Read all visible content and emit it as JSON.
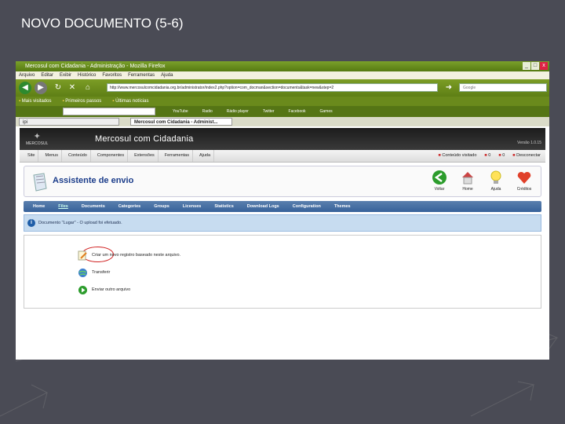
{
  "slide": {
    "title": "NOVO DOCUMENTO (5-6)"
  },
  "window": {
    "title": "Mercosul com Cidadania - Administração - Mozilla Firefox",
    "controls": [
      "_",
      "□",
      "x"
    ]
  },
  "menubar": [
    "Arquivo",
    "Editar",
    "Exibir",
    "Histórico",
    "Favoritos",
    "Ferramentas",
    "Ajuda"
  ],
  "navbar": {
    "url": "http://www.mercosulcomcidadania.org.br/administrator/index2.php?option=com_docman&section=documents&task=new&step=2",
    "search_placeholder": "Google"
  },
  "bookmarks": [
    "Mais visitados",
    "Primeiros passos",
    "Últimas notícias"
  ],
  "toolbar2": {
    "items": [
      "YouTube",
      "Radio",
      "Rádio player",
      "Twitter",
      "Facebook",
      "Games"
    ]
  },
  "tabs": [
    {
      "label": "ipi"
    },
    {
      "label": "Mercosul com Cidadania - Administ..."
    }
  ],
  "site": {
    "logo_text": "MERCOSUL",
    "title": "Mercosul com Cidadania",
    "version": "Versão 1.0.15"
  },
  "admin_menu": {
    "items": [
      "Site",
      "Menus",
      "Conteúdo",
      "Componentes",
      "Extensões",
      "Ferramentas",
      "Ajuda"
    ],
    "status": [
      "Conteúdo visitado",
      "0",
      "0",
      "Desconectar"
    ]
  },
  "page": {
    "heading": "Assistente de envio",
    "buttons": [
      "Voltar",
      "Home",
      "Ajuda",
      "Créditos"
    ]
  },
  "submenu": [
    "Home",
    "Files",
    "Documents",
    "Categories",
    "Groups",
    "Licenses",
    "Statistics",
    "Download Logs",
    "Configuration",
    "Themes"
  ],
  "message": "Documento \"Lugar\" - O upload foi efetuado.",
  "actions": [
    "Criar um novo registro baseado neste arquivo.",
    "Transferir",
    "Enviar outro arquivo"
  ]
}
